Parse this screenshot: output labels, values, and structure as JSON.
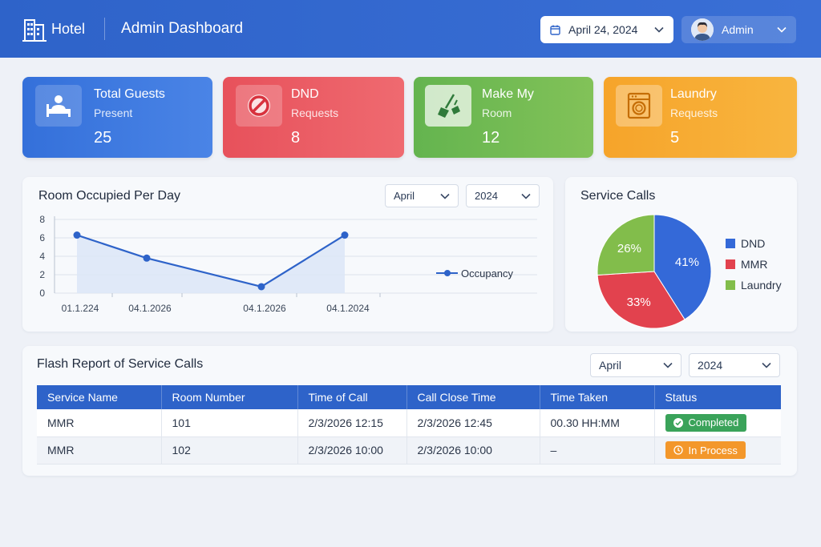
{
  "header": {
    "brand": "Hotel",
    "title": "Admin Dashboard",
    "date": "April 24, 2024",
    "user": "Admin"
  },
  "stats": [
    {
      "title": "Total Guests",
      "sub": "Present",
      "value": "25",
      "color": "#3a74dc",
      "icon": "guest-bed-icon"
    },
    {
      "title": "DND",
      "sub": "Requests",
      "value": "8",
      "color": "#ea5a62",
      "icon": "no-entry-icon"
    },
    {
      "title": "Make My",
      "sub": "Room",
      "value": "12",
      "color": "#6bb84e",
      "icon": "broom-icon"
    },
    {
      "title": "Laundry",
      "sub": "Requests",
      "value": "5",
      "color": "#f5a931",
      "icon": "washing-machine-icon"
    }
  ],
  "occupancy": {
    "title": "Room Occupied Per Day",
    "month": "April",
    "year": "2024"
  },
  "service_calls": {
    "title": "Service Calls"
  },
  "flash_report": {
    "title": "Flash Report of Service Calls",
    "month": "April",
    "year": "2024",
    "columns": [
      "Service Name",
      "Room Number",
      "Time of Call",
      "Call Close Time",
      "Time Taken",
      "Status"
    ],
    "rows": [
      [
        "MMR",
        "101",
        "2/3/2026 12:15",
        "2/3/2026 12:45",
        "00.30 HH:MM",
        "Completed"
      ],
      [
        "MMR",
        "102",
        "2/3/2026 10:00",
        "2/3/2026 10:00",
        "–",
        "In Process"
      ]
    ]
  },
  "chart_data": [
    {
      "type": "line",
      "title": "Room Occupied Per Day",
      "x": [
        "01.1.224",
        "04.1.2026",
        "04.1.2026",
        "04.1.2024"
      ],
      "series": [
        {
          "name": "Occupancy",
          "values": [
            6.3,
            3.8,
            0.7,
            6.3
          ]
        }
      ],
      "yticks": [
        "0",
        "2",
        "4",
        "6",
        "8"
      ],
      "ylim": [
        0,
        8
      ],
      "grid": true,
      "legend": "right",
      "color": "#2e63c9"
    },
    {
      "type": "pie",
      "title": "Service Calls",
      "labels": [
        "DND",
        "MMR",
        "Laundry"
      ],
      "slice_labels": [
        "41%",
        "33%",
        "26%"
      ],
      "values": [
        41,
        33,
        26
      ],
      "colors": [
        "#3469d8",
        "#e2424e",
        "#82bd4b"
      ],
      "legend": "right"
    }
  ]
}
